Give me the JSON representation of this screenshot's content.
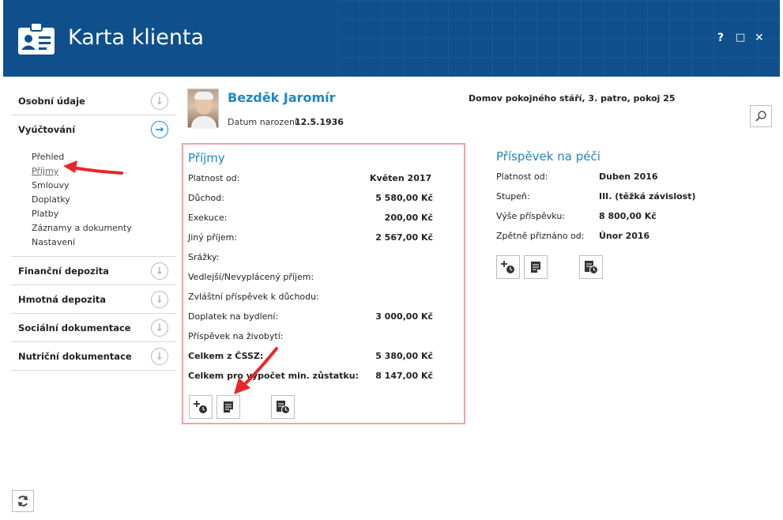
{
  "window": {
    "title": "Karta klienta",
    "help": "?",
    "maximize": "□",
    "close": "✕"
  },
  "sidebar": {
    "items": [
      {
        "label": "Osobní údaje",
        "icon": "chevron-down-circle-icon"
      },
      {
        "label": "Vyúčtování",
        "icon": "chevron-right-circle-icon"
      },
      {
        "label": "Finanční depozita",
        "icon": "chevron-down-circle-icon"
      },
      {
        "label": "Hmotná depozita",
        "icon": "chevron-down-circle-icon"
      },
      {
        "label": "Sociální dokumentace",
        "icon": "chevron-down-circle-icon"
      },
      {
        "label": "Nutriční dokumentace",
        "icon": "chevron-down-circle-icon"
      }
    ],
    "sub_items": [
      "Přehled",
      "Příjmy",
      "Smlouvy",
      "Doplatky",
      "Platby",
      "Záznamy a dokumenty",
      "Nastavení"
    ],
    "selected_sub": "Příjmy"
  },
  "client": {
    "name": "Bezděk Jaromír",
    "dob_label": "Datum narození:",
    "dob": "12.5.1936",
    "location": "Domov pokojného stáří, 3. patro, pokoj 25"
  },
  "income": {
    "title": "Příjmy",
    "rows": [
      {
        "label": "Platnost od:",
        "value": "Květen 2017"
      },
      {
        "label": "Důchod:",
        "value": "5 580,00 Kč"
      },
      {
        "label": "Exekuce:",
        "value": "200,00 Kč"
      },
      {
        "label": "Jiný příjem:",
        "value": "2 567,00 Kč"
      },
      {
        "label": "Srážky:",
        "value": ""
      },
      {
        "label": "Vedlejší/Nevyplácený příjem:",
        "value": ""
      },
      {
        "label": "Zvláštní příspěvek k důchodu:",
        "value": ""
      },
      {
        "label": "Doplatek na bydlení:",
        "value": "3 000,00 Kč"
      },
      {
        "label": "Příspěvek na živobytí:",
        "value": ""
      },
      {
        "label": "Celkem z ČSSZ:",
        "value": "5 380,00 Kč"
      },
      {
        "label": "Celkem pro výpočet min. zůstatku:",
        "value": "8 147,00 Kč"
      }
    ]
  },
  "care": {
    "title": "Příspěvek na péči",
    "rows": [
      {
        "label": "Platnost od:",
        "value": "Duben 2016"
      },
      {
        "label": "Stupeň:",
        "value": "III. (těžká závislost)"
      },
      {
        "label": "Výše příspěvku:",
        "value": "8 800,00 Kč"
      },
      {
        "label": "Zpětně přiznáno od:",
        "value": "Únor 2016"
      }
    ]
  },
  "colors": {
    "header": "#0f4f8c",
    "accent": "#1f86c8",
    "highlight_border": "#f0a3a3",
    "annotation": "#e8262b"
  }
}
